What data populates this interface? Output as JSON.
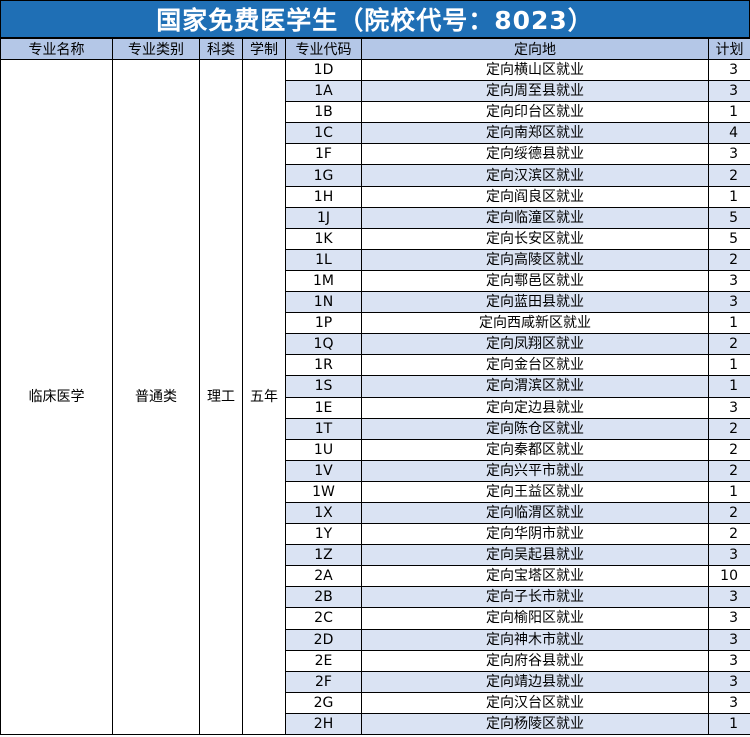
{
  "title": "国家免费医学生（院校代号：8023）",
  "headers": {
    "major": "专业名称",
    "category": "专业类别",
    "subject": "科类",
    "duration": "学制",
    "code": "专业代码",
    "destination": "定向地",
    "plan": "计划"
  },
  "merged": {
    "major": "临床医学",
    "category": "普通类",
    "subject": "理工",
    "duration": "五年"
  },
  "rows": [
    {
      "code": "1D",
      "destination": "定向横山区就业",
      "plan": "3"
    },
    {
      "code": "1A",
      "destination": "定向周至县就业",
      "plan": "3"
    },
    {
      "code": "1B",
      "destination": "定向印台区就业",
      "plan": "1"
    },
    {
      "code": "1C",
      "destination": "定向南郑区就业",
      "plan": "4"
    },
    {
      "code": "1F",
      "destination": "定向绥德县就业",
      "plan": "3"
    },
    {
      "code": "1G",
      "destination": "定向汉滨区就业",
      "plan": "2"
    },
    {
      "code": "1H",
      "destination": "定向阎良区就业",
      "plan": "1"
    },
    {
      "code": "1J",
      "destination": "定向临潼区就业",
      "plan": "5"
    },
    {
      "code": "1K",
      "destination": "定向长安区就业",
      "plan": "5"
    },
    {
      "code": "1L",
      "destination": "定向高陵区就业",
      "plan": "2"
    },
    {
      "code": "1M",
      "destination": "定向鄠邑区就业",
      "plan": "3"
    },
    {
      "code": "1N",
      "destination": "定向蓝田县就业",
      "plan": "3"
    },
    {
      "code": "1P",
      "destination": "定向西咸新区就业",
      "plan": "1"
    },
    {
      "code": "1Q",
      "destination": "定向凤翔区就业",
      "plan": "2"
    },
    {
      "code": "1R",
      "destination": "定向金台区就业",
      "plan": "1"
    },
    {
      "code": "1S",
      "destination": "定向渭滨区就业",
      "plan": "1"
    },
    {
      "code": "1E",
      "destination": "定向定边县就业",
      "plan": "3"
    },
    {
      "code": "1T",
      "destination": "定向陈仓区就业",
      "plan": "2"
    },
    {
      "code": "1U",
      "destination": "定向秦都区就业",
      "plan": "2"
    },
    {
      "code": "1V",
      "destination": "定向兴平市就业",
      "plan": "2"
    },
    {
      "code": "1W",
      "destination": "定向王益区就业",
      "plan": "1"
    },
    {
      "code": "1X",
      "destination": "定向临渭区就业",
      "plan": "2"
    },
    {
      "code": "1Y",
      "destination": "定向华阴市就业",
      "plan": "2"
    },
    {
      "code": "1Z",
      "destination": "定向吴起县就业",
      "plan": "3"
    },
    {
      "code": "2A",
      "destination": "定向宝塔区就业",
      "plan": "10"
    },
    {
      "code": "2B",
      "destination": "定向子长市就业",
      "plan": "3"
    },
    {
      "code": "2C",
      "destination": "定向榆阳区就业",
      "plan": "3"
    },
    {
      "code": "2D",
      "destination": "定向神木市就业",
      "plan": "3"
    },
    {
      "code": "2E",
      "destination": "定向府谷县就业",
      "plan": "3"
    },
    {
      "code": "2F",
      "destination": "定向靖边县就业",
      "plan": "3"
    },
    {
      "code": "2G",
      "destination": "定向汉台区就业",
      "plan": "3"
    },
    {
      "code": "2H",
      "destination": "定向杨陵区就业",
      "plan": "1"
    }
  ]
}
